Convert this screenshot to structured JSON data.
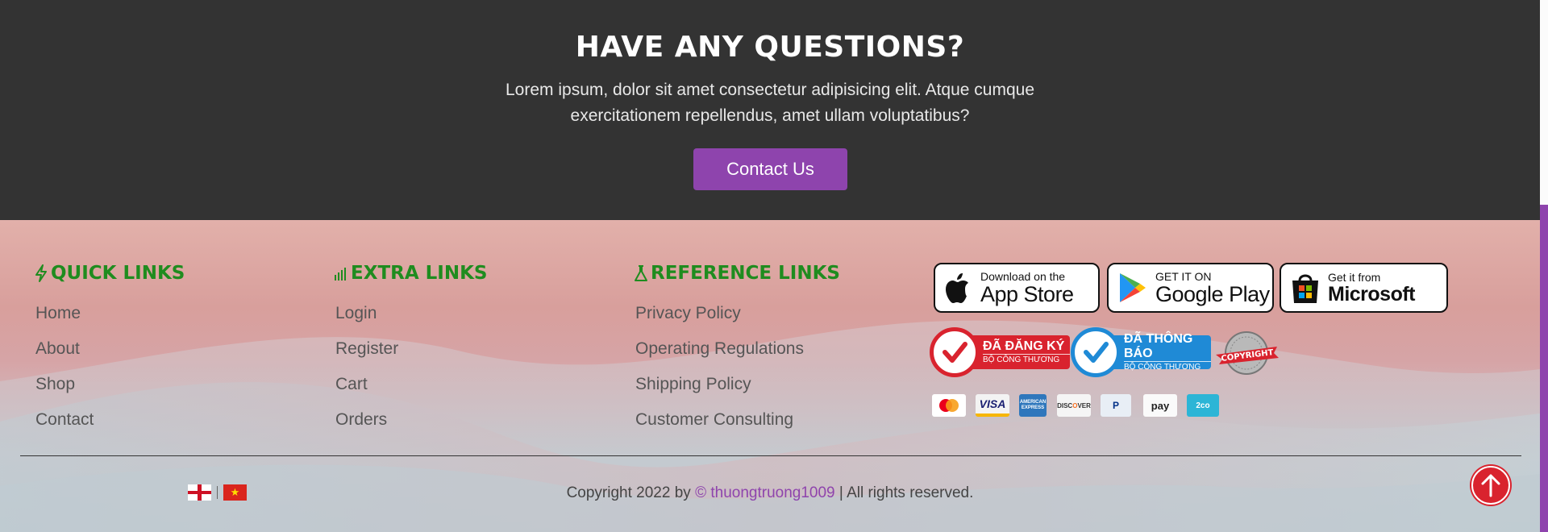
{
  "cta": {
    "title": "HAVE ANY QUESTIONS?",
    "description": "Lorem ipsum, dolor sit amet consectetur adipisicing elit. Atque cumque exercitationem repellendus, amet ullam voluptatibus?",
    "button_label": "Contact Us"
  },
  "footer": {
    "quick_links": {
      "title": "QUICK LINKS",
      "icon": "bolt-icon",
      "items": [
        "Home",
        "About",
        "Shop",
        "Contact"
      ]
    },
    "extra_links": {
      "title": "EXTRA LINKS",
      "icon": "bar-chart-icon",
      "items": [
        "Login",
        "Register",
        "Cart",
        "Orders"
      ]
    },
    "reference_links": {
      "title": "REFERENCE LINKS",
      "icon": "flask-icon",
      "items": [
        "Privacy Policy",
        "Operating Regulations",
        "Shipping Policy",
        "Customer Consulting"
      ]
    },
    "stores": [
      {
        "small": "Download on the",
        "big": "App Store",
        "icon": "apple-icon"
      },
      {
        "small": "GET IT ON",
        "big": "Google Play",
        "icon": "google-play-icon"
      },
      {
        "small": "Get it from",
        "big": "Microsoft",
        "icon": "microsoft-store-icon"
      }
    ],
    "certifications": [
      {
        "line1": "ĐÃ ĐĂNG KÝ",
        "line2": "BỘ CÔNG THƯƠNG",
        "color": "#d9232e"
      },
      {
        "line1": "ĐÃ THÔNG BÁO",
        "line2": "BỘ CÔNG THƯƠNG",
        "color": "#1f8ad6"
      }
    ],
    "copyright_seal": "COPYRIGHT",
    "payments": [
      "mastercard",
      "VISA",
      "AMERICAN EXPRESS",
      "DISCOVER",
      "PayPal",
      "pay",
      "2co"
    ],
    "copyright": {
      "prefix": "Copyright 2022 by",
      "brand": "© thuongtruong1009",
      "suffix": "| All rights reserved."
    },
    "languages": [
      "English",
      "Vietnamese"
    ]
  },
  "colors": {
    "accent": "#8e44ad",
    "heading_green": "#1f8c1f",
    "cta_bg": "#333333",
    "to_top": "#d9232e"
  }
}
